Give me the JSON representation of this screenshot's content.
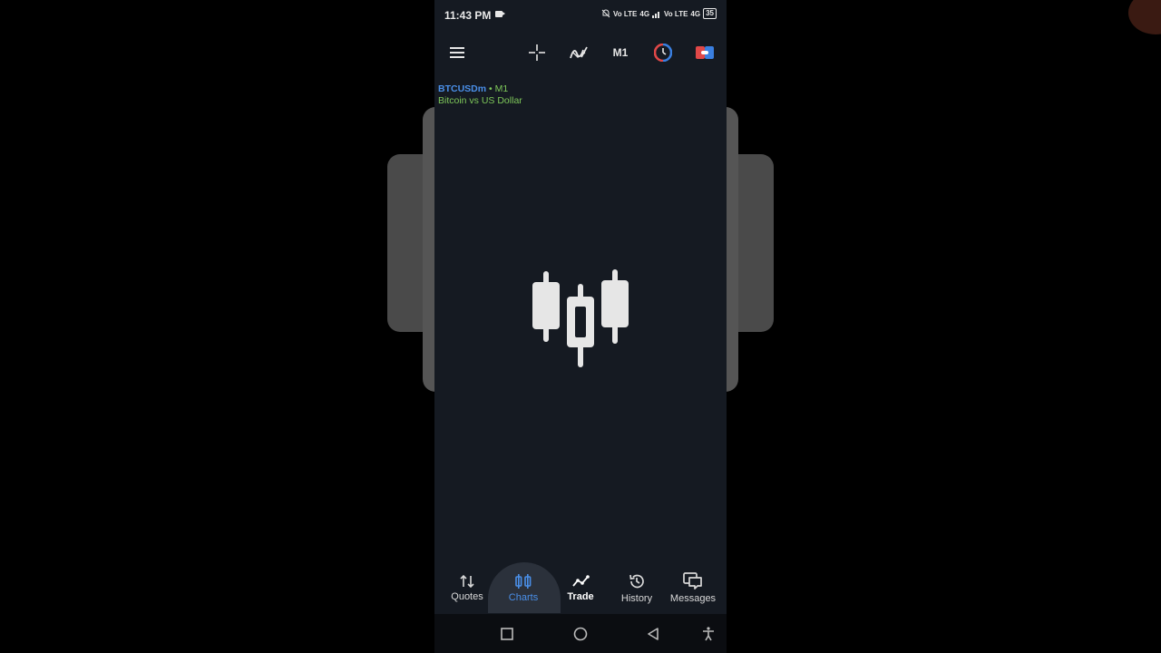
{
  "status": {
    "time": "11:43 PM",
    "net1": "Vo LTE",
    "net2": "4G",
    "net3": "Vo LTE",
    "net4": "4G",
    "battery": "35"
  },
  "toolbar": {
    "timeframe": "M1"
  },
  "chart": {
    "symbol": "BTCUSDm",
    "separator": "•",
    "timeframe": "M1",
    "description": "Bitcoin vs US Dollar"
  },
  "nav": {
    "quotes": "Quotes",
    "charts": "Charts",
    "trade": "Trade",
    "history": "History",
    "messages": "Messages"
  },
  "colors": {
    "accent": "#4a8fe8",
    "label_green": "#7ec85a",
    "background": "#151a22"
  }
}
